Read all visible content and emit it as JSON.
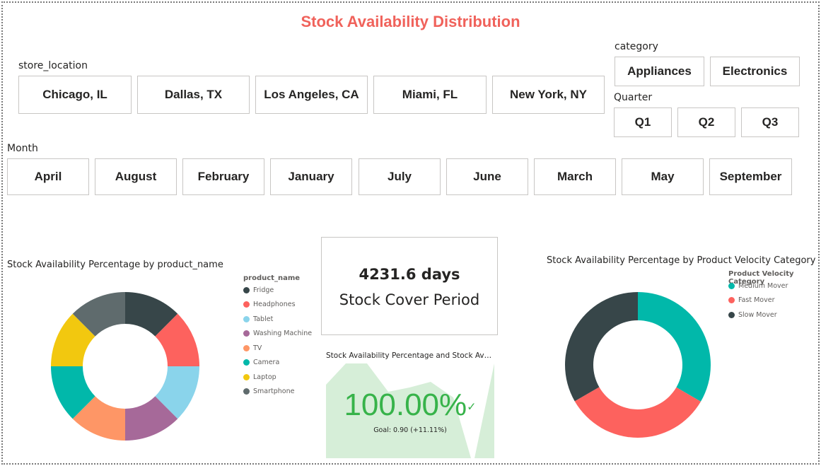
{
  "title": "Stock Availability Distribution",
  "slicers": {
    "store_location": {
      "label": "store_location",
      "options": [
        "Chicago, IL",
        "Dallas, TX",
        "Los Angeles, CA",
        "Miami, FL",
        "New York, NY"
      ]
    },
    "category": {
      "label": "category",
      "options": [
        "Appliances",
        "Electronics"
      ]
    },
    "quarter": {
      "label": "Quarter",
      "options": [
        "Q1",
        "Q2",
        "Q3"
      ]
    },
    "month": {
      "label": "Month",
      "options": [
        "April",
        "August",
        "February",
        "January",
        "July",
        "June",
        "March",
        "May",
        "September"
      ]
    }
  },
  "card": {
    "value": "4231.6 days",
    "label": "Stock Cover Period"
  },
  "kpi": {
    "title": "Stock Availability Percentage and Stock Availabili...",
    "value": "100.00%",
    "check_icon": "checkmark-icon",
    "goal": "Goal: 0.90 (+11.11%)",
    "color": "#37b34a",
    "area_color": "#d6eed8"
  },
  "chart_data": [
    {
      "type": "pie",
      "donut": true,
      "title": "Stock Availability Percentage by product_name",
      "legend_title": "product_name",
      "legend_position": "right",
      "categories": [
        "Fridge",
        "Headphones",
        "Tablet",
        "Washing Machine",
        "TV",
        "Camera",
        "Laptop",
        "Smartphone"
      ],
      "values": [
        12.5,
        12.5,
        12.5,
        12.5,
        12.5,
        12.5,
        12.5,
        12.5
      ],
      "colors": [
        "#374649",
        "#fd625e",
        "#8ad4eb",
        "#a66999",
        "#fe9666",
        "#01b8aa",
        "#f2c80f",
        "#5f6b6d"
      ]
    },
    {
      "type": "pie",
      "donut": true,
      "title": "Stock Availability Percentage by Product Velocity Category",
      "legend_title": "Product Velocity Category",
      "legend_position": "top-right",
      "categories": [
        "Medium Mover",
        "Fast Mover",
        "Slow Mover"
      ],
      "values": [
        33.4,
        33.3,
        33.3
      ],
      "colors": [
        "#01b8aa",
        "#fd625e",
        "#374649"
      ]
    }
  ]
}
